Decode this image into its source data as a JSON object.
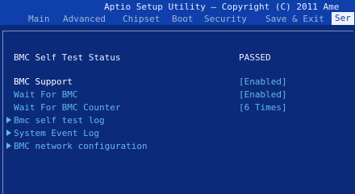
{
  "header": {
    "title": "Aptio Setup Utility – Copyright (C) 2011 Ame"
  },
  "tabs": [
    {
      "label": "Main"
    },
    {
      "label": "Advanced"
    },
    {
      "label": "Chipset"
    },
    {
      "label": "Boot"
    },
    {
      "label": "Security"
    },
    {
      "label": "Save & Exit"
    },
    {
      "label": "Ser",
      "active": true
    }
  ],
  "settings": {
    "self_test_status": {
      "label": "BMC Self Test Status",
      "value": "PASSED"
    },
    "bmc_support": {
      "label": "BMC Support",
      "value": "[Enabled]"
    },
    "wait_for_bmc": {
      "label": "Wait For BMC",
      "value": "[Enabled]"
    },
    "wait_for_bmc_counter": {
      "label": "Wait For BMC Counter",
      "value": "[6 Times]"
    }
  },
  "submenus": [
    {
      "label": "Bmc self test log"
    },
    {
      "label": "System Event Log"
    },
    {
      "label": "BMC network configuration"
    }
  ],
  "colors": {
    "background": "#0b2a7a",
    "header": "#0e3faa",
    "option_text": "#66b7e8",
    "static_text": "#e8ecff",
    "active_tab_bg": "#eef2ff"
  }
}
